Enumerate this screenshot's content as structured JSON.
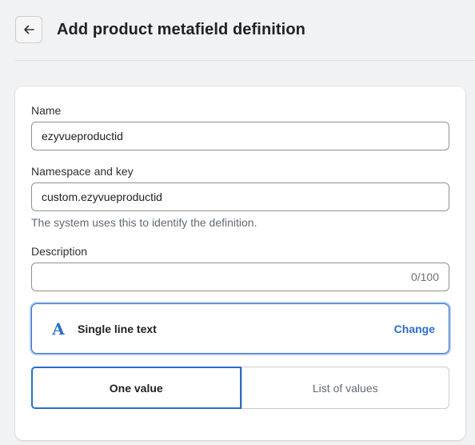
{
  "header": {
    "back_icon": "arrow-left-icon",
    "title": "Add product metafield definition"
  },
  "form": {
    "name": {
      "label": "Name",
      "value": "ezyvueproductid"
    },
    "namespace_key": {
      "label": "Namespace and key",
      "value": "custom.ezyvueproductid",
      "help_text": "The system uses this to identify the definition."
    },
    "description": {
      "label": "Description",
      "value": "",
      "counter": "0/100"
    },
    "type": {
      "icon_glyph": "A",
      "icon": "text-type-icon",
      "label": "Single line text",
      "change_label": "Change"
    },
    "value_mode": {
      "options": [
        "One value",
        "List of values"
      ],
      "selected": "One value"
    }
  },
  "colors": {
    "accent": "#2c6ecb",
    "background": "#f1f2f4",
    "card": "#ffffff"
  }
}
